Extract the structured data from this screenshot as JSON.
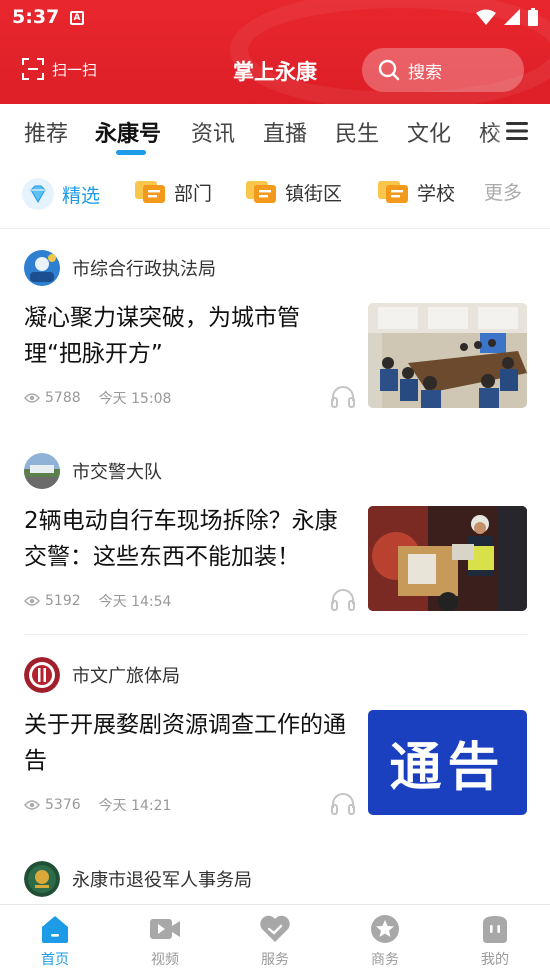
{
  "status_bar": {
    "time": "5:37"
  },
  "header": {
    "scan_label": "扫一扫",
    "title": "掌上永康",
    "search_label": "搜索"
  },
  "tabs": [
    {
      "label": "推荐"
    },
    {
      "label": "永康号"
    },
    {
      "label": "资讯"
    },
    {
      "label": "直播"
    },
    {
      "label": "民生"
    },
    {
      "label": "文化"
    },
    {
      "label": "校"
    }
  ],
  "active_tab": "永康号",
  "subtabs": [
    {
      "label": "精选",
      "icon": "diamond-icon"
    },
    {
      "label": "部门",
      "icon": "chat-badge-icon"
    },
    {
      "label": "镇街区",
      "icon": "chat-badge-icon"
    },
    {
      "label": "学校",
      "icon": "chat-badge-icon"
    },
    {
      "label": "更多"
    }
  ],
  "articles": [
    {
      "source": "市综合行政执法局",
      "title": "凝心聚力谋突破，为城市管理“把脉开方”",
      "views": "5788",
      "time": "今天 15:08"
    },
    {
      "source": "市交警大队",
      "title": "2辆电动自行车现场拆除？永康交警：这些东西不能加装！",
      "views": "5192",
      "time": "今天 14:54"
    },
    {
      "source": "市文广旅体局",
      "title": "关于开展婺剧资源调查工作的通告",
      "views": "5376",
      "time": "今天 14:21",
      "thumb_text": "通告"
    },
    {
      "source": "永康市退役军人事务局"
    }
  ],
  "bottom_nav": [
    {
      "label": "首页"
    },
    {
      "label": "视频"
    },
    {
      "label": "服务"
    },
    {
      "label": "商务"
    },
    {
      "label": "我的"
    }
  ],
  "colors": {
    "brand_red": "#e8262e",
    "accent_blue": "#1e9be6",
    "notice_blue": "#1a3fbf"
  }
}
